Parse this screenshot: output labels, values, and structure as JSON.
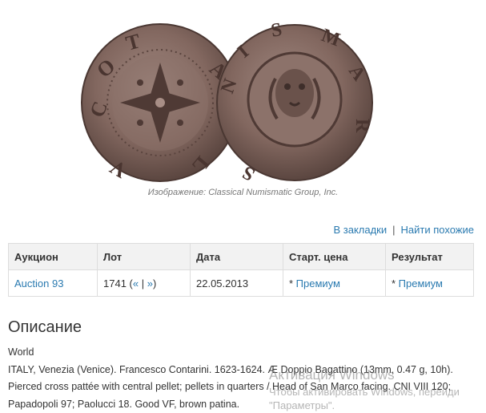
{
  "image": {
    "caption": "Изображение: Classical Numismatic Group, Inc."
  },
  "actions": {
    "bookmark_label": "В закладки",
    "separator": "|",
    "find_similar_label": "Найти похожие"
  },
  "table": {
    "headers": {
      "auction": "Аукцион",
      "lot": "Лот",
      "date": "Дата",
      "start_price": "Старт. цена",
      "result": "Результат"
    },
    "row": {
      "auction": "Auction 93",
      "lot_number": "1741",
      "lot_nav_open": "(",
      "lot_prev": "«",
      "lot_nav_sep": "|",
      "lot_next": "»",
      "lot_nav_close": ")",
      "date": "22.05.2013",
      "start_price_prefix": "* ",
      "start_price_link": "Премиум",
      "result_prefix": "* ",
      "result_link": "Премиум"
    }
  },
  "description": {
    "title": "Описание",
    "lines": [
      "World",
      "ITALY, Venezia (Venice). Francesco Contarini. 1623-1624. Æ Doppio Bagattino (13mm, 0.47 g, 10h).",
      "Pierced cross pattée with central pellet; pellets in quarters / Head of San Marco facing. CNI VIII 120;",
      "Papadopoli 97; Paolucci 18. Good VF, brown patina."
    ]
  },
  "watermark": {
    "line1": "Активация Windows",
    "line2": "Чтобы активировать Windows, перейди",
    "line3": "\"Параметры\"."
  },
  "colors": {
    "link": "#2a7ab0",
    "coin_base": "#8a6e66",
    "coin_dark": "#4f3a35"
  }
}
